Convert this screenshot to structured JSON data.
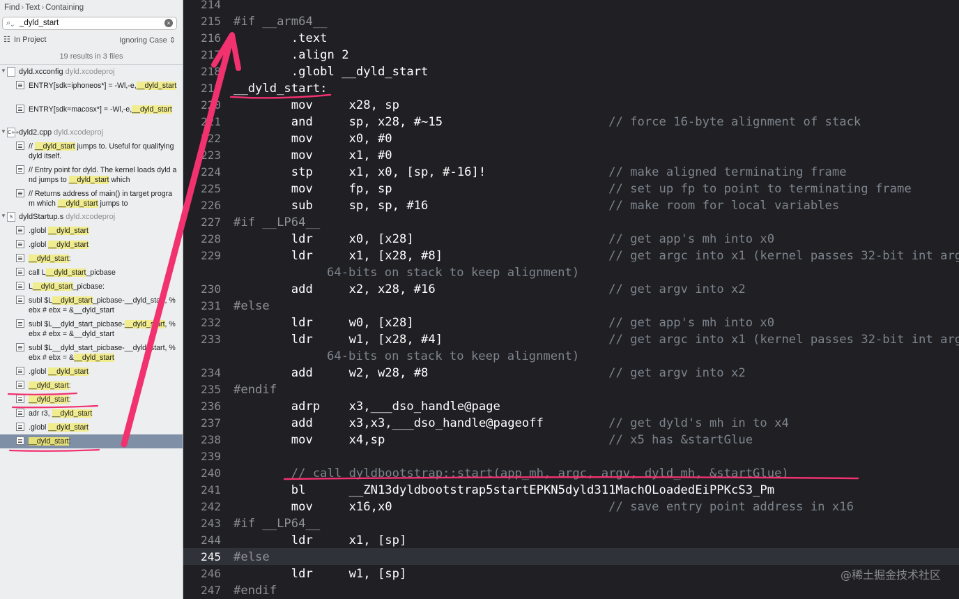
{
  "breadcrumb": [
    "Find",
    "Text",
    "Containing"
  ],
  "search": {
    "value": "_dyld_start"
  },
  "scope": {
    "label": "In Project",
    "case": "Ignoring Case"
  },
  "summary": "19 results in 3 files",
  "files": [
    {
      "icon": "plain-file-icon",
      "glyph": "",
      "name": "dyld.xcconfig",
      "project": "dyld.xcodeproj",
      "matches": [
        {
          "parts": [
            "ENTRY[sdk=iphoneos*]      = -Wl,-e,",
            "__dyld_start",
            ""
          ],
          "lines": 2
        },
        {
          "parts": [
            "ENTRY[sdk=macosx*]       = -Wl,-e,",
            "__dyld_start",
            ""
          ],
          "lines": 2
        }
      ]
    },
    {
      "icon": "cpp-file-icon",
      "glyph": "C++",
      "name": "dyld2.cpp",
      "project": "dyld.xcodeproj",
      "matches": [
        {
          "parts": [
            "// ",
            "__dyld_start",
            " jumps to. Useful for qualifying dyld itself."
          ],
          "lines": 2
        },
        {
          "parts": [
            "// Entry point for dyld.  The kernel loads dyld and jumps to ",
            "__dyld_start",
            " which"
          ],
          "lines": 2
        },
        {
          "parts": [
            "// Returns address of main() in target program which ",
            "__dyld_start",
            " jumps to"
          ],
          "lines": 2
        }
      ]
    },
    {
      "icon": "asm-file-icon",
      "glyph": "S",
      "name": "dyldStartup.s",
      "project": "dyld.xcodeproj",
      "matches": [
        {
          "parts": [
            ".globl ",
            "__dyld_start",
            ""
          ],
          "lines": 1
        },
        {
          "parts": [
            ".globl ",
            "__dyld_start",
            ""
          ],
          "lines": 1
        },
        {
          "parts": [
            "",
            "__dyld_start",
            ":"
          ],
          "lines": 1
        },
        {
          "parts": [
            "call    L",
            "__dyld_start",
            "_picbase"
          ],
          "lines": 1
        },
        {
          "parts": [
            "L",
            "__dyld_start",
            "_picbase:"
          ],
          "lines": 1
        },
        {
          "parts": [
            "subl  $L",
            "__dyld_start",
            "_picbase-__dyld_start, %ebx # ebx = &__dyld_start"
          ],
          "lines": 2
        },
        {
          "parts": [
            "subl  $L__dyld_start_picbase-",
            "__dyld_start",
            ", %ebx # ebx = &__dyld_start"
          ],
          "lines": 2
        },
        {
          "parts": [
            "subl  $L__dyld_start_picbase-__dyld_start, %ebx # ebx = &",
            "__dyld_start",
            ""
          ],
          "lines": 2
        },
        {
          "parts": [
            ".globl ",
            "__dyld_start",
            ""
          ],
          "lines": 1
        },
        {
          "parts": [
            "",
            "__dyld_start",
            ":"
          ],
          "lines": 1
        },
        {
          "parts": [
            "",
            "__dyld_start",
            ":"
          ],
          "lines": 1
        },
        {
          "parts": [
            "adr    r3, ",
            "__dyld_start",
            ""
          ],
          "lines": 1
        },
        {
          "parts": [
            ".globl ",
            "__dyld_start",
            ""
          ],
          "lines": 1
        },
        {
          "parts": [
            "",
            "__dyld_start",
            ":"
          ],
          "lines": 1,
          "selected": true
        }
      ]
    }
  ],
  "editor": {
    "current_line": 245,
    "lines": [
      {
        "n": "214",
        "code": ""
      },
      {
        "n": "215",
        "code": "#if __arm64__",
        "kind": "pp"
      },
      {
        "n": "216",
        "code": "        .text"
      },
      {
        "n": "217",
        "code": "        .align 2"
      },
      {
        "n": "218",
        "code": "        .globl __dyld_start"
      },
      {
        "n": "219",
        "code": "__dyld_start:"
      },
      {
        "n": "220",
        "code": "        mov     x28, sp"
      },
      {
        "n": "221",
        "code": "        and     sp, x28, #~15",
        "comment": "// force 16-byte alignment of stack"
      },
      {
        "n": "222",
        "code": "        mov     x0, #0"
      },
      {
        "n": "223",
        "code": "        mov     x1, #0"
      },
      {
        "n": "224",
        "code": "        stp     x1, x0, [sp, #-16]!",
        "comment": "// make aligned terminating frame"
      },
      {
        "n": "225",
        "code": "        mov     fp, sp",
        "comment": "// set up fp to point to terminating frame"
      },
      {
        "n": "226",
        "code": "        sub     sp, sp, #16",
        "comment": "// make room for local variables"
      },
      {
        "n": "227",
        "code": "#if __LP64__",
        "kind": "pp"
      },
      {
        "n": "228",
        "code": "        ldr     x0, [x28]",
        "comment": "// get app's mh into x0"
      },
      {
        "n": "229",
        "code": "        ldr     x1, [x28, #8]",
        "comment": "// get argc into x1 (kernel passes 32-bit int argc as",
        "cont": "64-bits on stack to keep alignment)"
      },
      {
        "n": "230",
        "code": "        add     x2, x28, #16",
        "comment": "// get argv into x2"
      },
      {
        "n": "231",
        "code": "#else",
        "kind": "pp"
      },
      {
        "n": "232",
        "code": "        ldr     w0, [x28]",
        "comment": "// get app's mh into x0"
      },
      {
        "n": "233",
        "code": "        ldr     w1, [x28, #4]",
        "comment": "// get argc into x1 (kernel passes 32-bit int argc as",
        "cont": "64-bits on stack to keep alignment)"
      },
      {
        "n": "234",
        "code": "        add     w2, w28, #8",
        "comment": "// get argv into x2"
      },
      {
        "n": "235",
        "code": "#endif",
        "kind": "pp"
      },
      {
        "n": "236",
        "code": "        adrp    x3,___dso_handle@page"
      },
      {
        "n": "237",
        "code": "        add     x3,x3,___dso_handle@pageoff",
        "comment": "// get dyld's mh in to x4"
      },
      {
        "n": "238",
        "code": "        mov     x4,sp",
        "comment": "// x5 has &startGlue"
      },
      {
        "n": "239",
        "code": ""
      },
      {
        "n": "240",
        "code": "        // call dyldbootstrap::start(app_mh, argc, argv, dyld_mh, &startGlue)",
        "kind": "cmt"
      },
      {
        "n": "241",
        "code": "        bl      __ZN13dyldbootstrap5startEPKN5dyld311MachOLoadedEiPPKcS3_Pm"
      },
      {
        "n": "242",
        "code": "        mov     x16,x0",
        "comment": "// save entry point address in x16"
      },
      {
        "n": "243",
        "code": "#if __LP64__",
        "kind": "pp"
      },
      {
        "n": "244",
        "code": "        ldr     x1, [sp]"
      },
      {
        "n": "245",
        "code": "#else",
        "kind": "pp"
      },
      {
        "n": "246",
        "code": "        ldr     w1, [sp]"
      },
      {
        "n": "247",
        "code": "#endif",
        "kind": "pp"
      }
    ]
  },
  "watermark": "@稀土掘金技术社区",
  "colors": {
    "annotation": "#f2316f",
    "highlight": "#f1ec8e",
    "selection": "#7f8fa5",
    "editor_bg": "#1f1f24"
  }
}
